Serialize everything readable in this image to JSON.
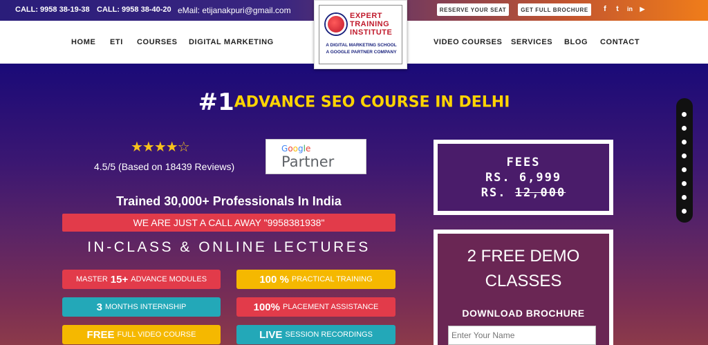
{
  "topbar": {
    "call1": "CALL: 9958 38-19-38",
    "call2": "CALL: 9958 38-40-20",
    "email": "eMail: etijanakpuri@gmail.com",
    "reserve_btn": "RESERVE YOUR SEAT",
    "brochure_btn": "GET FULL BROCHURE",
    "social": [
      {
        "icon": "facebook-icon",
        "glyph": "f"
      },
      {
        "icon": "twitter-icon",
        "glyph": "t"
      },
      {
        "icon": "linkedin-icon",
        "glyph": "in"
      },
      {
        "icon": "youtube-icon",
        "glyph": "▶"
      }
    ]
  },
  "nav": {
    "home": "HOME",
    "eti": "ETI",
    "courses": "COURSES",
    "digital_marketing": "DIGITAL MARKETING",
    "video_courses": "VIDEO COURSES",
    "services": "SERVICES",
    "blog": "BLOG",
    "contact": "CONTACT"
  },
  "logo": {
    "line1": "EXPERT",
    "line2": "TRAINING",
    "line3": "INSTITUTE",
    "sub1": "A DIGITAL MARKETING SCHOOL",
    "sub2": "A GOOGLE PARTNER COMPANY"
  },
  "hero": {
    "title_num": "#1",
    "title_rest": "ADVANCE SEO COURSE IN DELHI",
    "stars": "★★★★☆",
    "rating_value": 4.5,
    "rating_text": "4.5/5 (Based on 18439 Reviews)",
    "google_word": "Google",
    "partner_word": "Partner",
    "trained": "Trained 30,000+ Professionals In India",
    "call_away": "WE ARE JUST A CALL AWAY \"9958381938\"",
    "lectures": "IN-CLASS & ONLINE LECTURES"
  },
  "features": [
    {
      "bold": "15+",
      "pre": "MASTER",
      "rest": "ADVANCE MODULES",
      "color": "#e23b4a"
    },
    {
      "bold": "100 %",
      "pre": "",
      "rest": "PRACTICAL TRAINING",
      "color": "#f5b800"
    },
    {
      "bold": "3",
      "pre": "",
      "rest": "MONTHS INTERNSHIP",
      "color": "#23a8b8"
    },
    {
      "bold": "100%",
      "pre": "",
      "rest": "PLACEMENT ASSISTANCE",
      "color": "#e23b4a"
    },
    {
      "bold": "FREE",
      "pre": "",
      "rest": "FULL VIDEO COURSE",
      "color": "#f5b800"
    },
    {
      "bold": "LIVE",
      "pre": "",
      "rest": "SESSION RECORDINGS",
      "color": "#23a8b8"
    }
  ],
  "fees": {
    "label": "FEES",
    "price": "RS. 6,999",
    "old_prefix": "RS.",
    "old_price": "12,000"
  },
  "demo": {
    "heading_line1": "2 FREE DEMO",
    "heading_line2": "CLASSES",
    "download": "DOWNLOAD BROCHURE",
    "name_placeholder": "Enter Your Name"
  }
}
